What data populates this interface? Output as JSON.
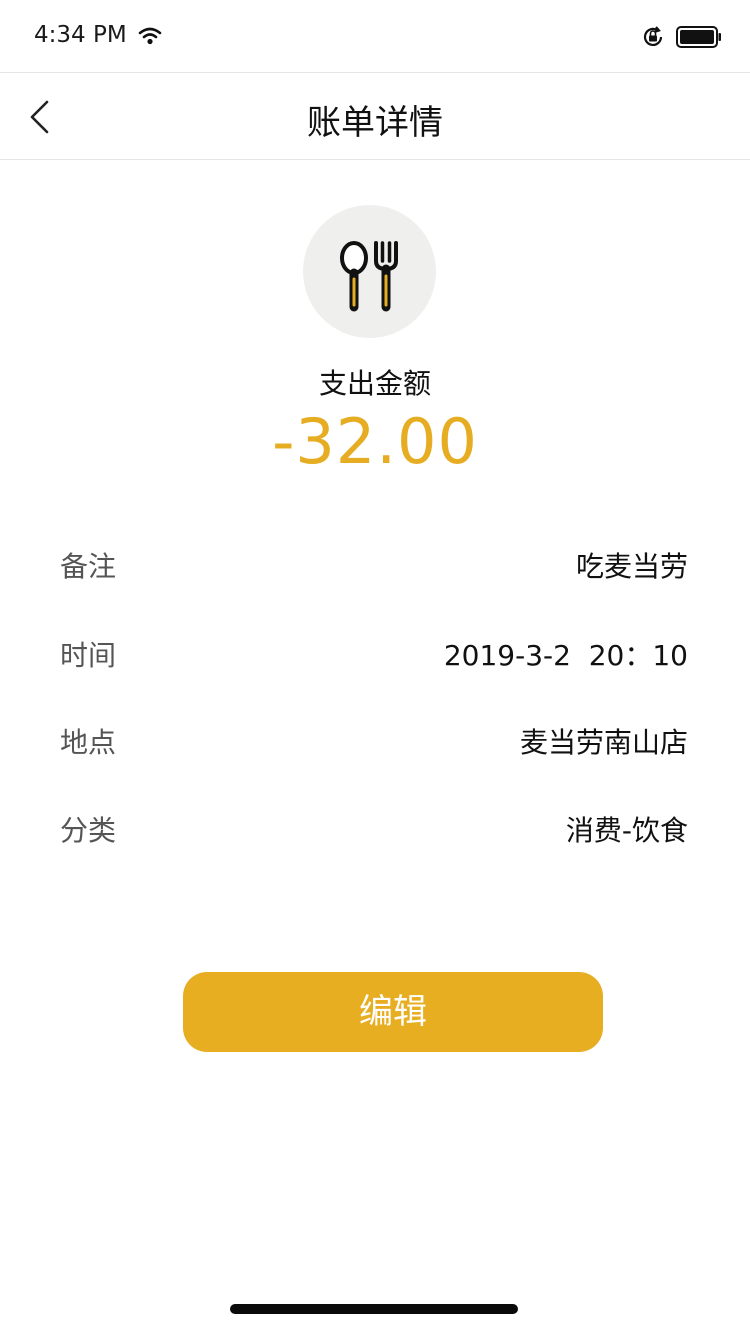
{
  "status_bar": {
    "time": "4:34 PM",
    "icons": [
      "wifi-icon",
      "lock-rotation-icon",
      "battery-icon"
    ]
  },
  "nav": {
    "title": "账单详情",
    "back_icon": "chevron-left-icon"
  },
  "category": {
    "icon": "utensils-icon"
  },
  "amount": {
    "label": "支出金额",
    "value": "-32.00",
    "color": "#e6ad23"
  },
  "details": [
    {
      "key": "备注",
      "value": "吃麦当劳"
    },
    {
      "key": "时间",
      "value": "2019-3-2  20：10"
    },
    {
      "key": "地点",
      "value": "麦当劳南山店"
    },
    {
      "key": "分类",
      "value": "消费-饮食"
    }
  ],
  "edit_button": {
    "label": "编辑",
    "color": "#e8ae22"
  }
}
